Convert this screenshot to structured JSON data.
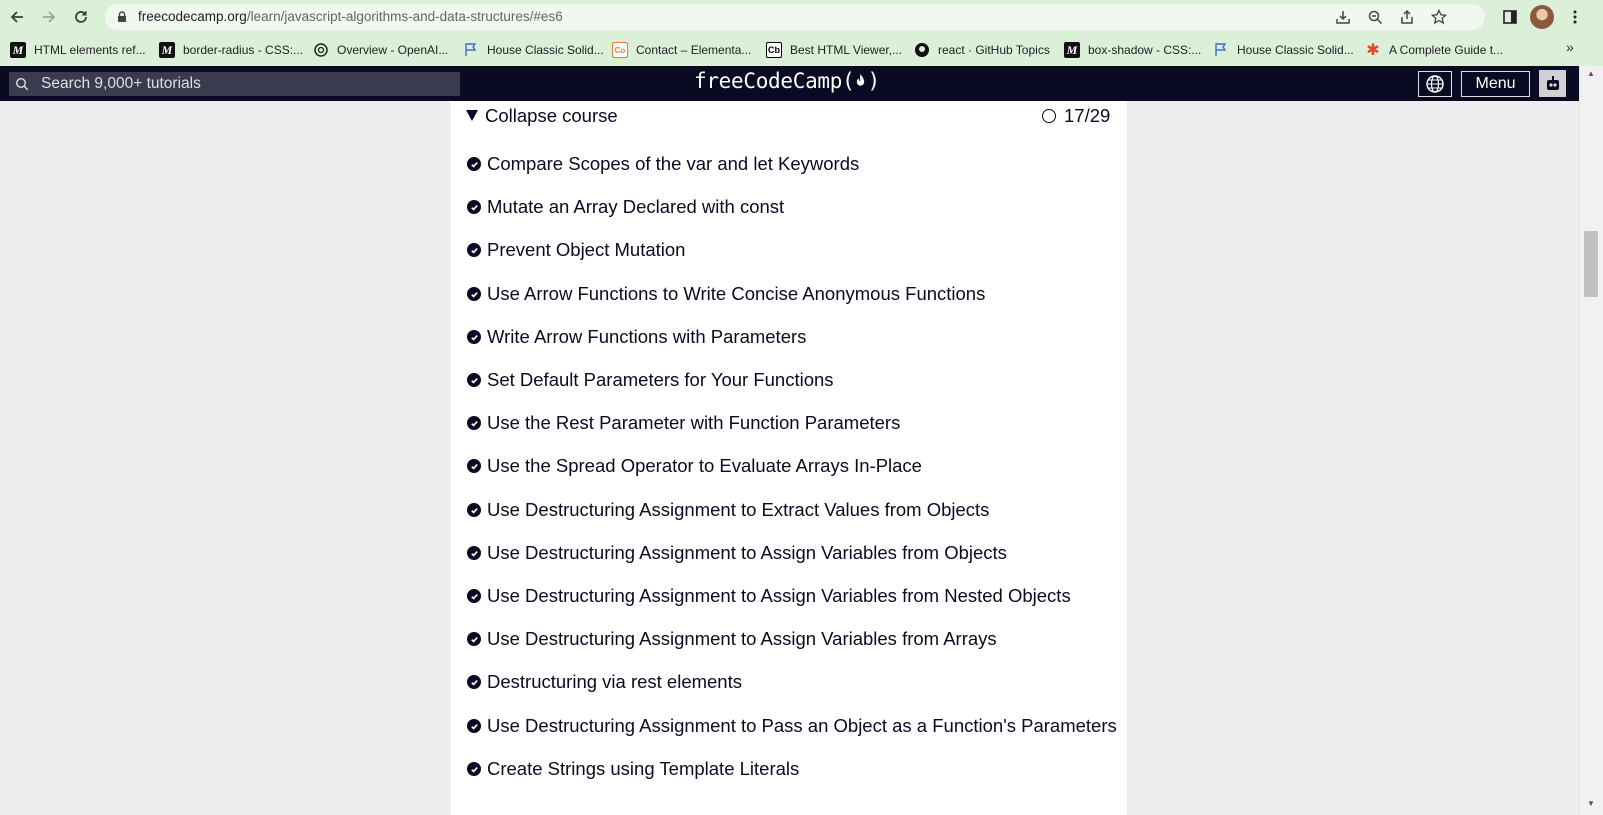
{
  "browser": {
    "url_host": "freecodecamp.org",
    "url_path": "/learn/javascript-algorithms-and-data-structures/#es6",
    "bookmarks": [
      {
        "label": "HTML elements ref...",
        "icon": "mdn-icon"
      },
      {
        "label": "border-radius - CSS:...",
        "icon": "mdn-icon"
      },
      {
        "label": "Overview - OpenAI...",
        "icon": "openai-icon"
      },
      {
        "label": "House Classic Solid...",
        "icon": "flag-icon"
      },
      {
        "label": "Contact – Elementa...",
        "icon": "codeorg-icon"
      },
      {
        "label": "Best HTML Viewer,...",
        "icon": "cb-icon"
      },
      {
        "label": "react · GitHub Topics",
        "icon": "github-icon"
      },
      {
        "label": "box-shadow - CSS:...",
        "icon": "mdn-icon"
      },
      {
        "label": "House Classic Solid...",
        "icon": "flag-icon"
      },
      {
        "label": "A Complete Guide t...",
        "icon": "asterisk-icon"
      }
    ],
    "more_bookmarks": "»"
  },
  "fcc": {
    "search_placeholder": "Search 9,000+ tutorials",
    "logo": "freeCodeCamp(🔥)",
    "logo_text": "freeCodeCamp(",
    "logo_end": ")",
    "menu_label": "Menu"
  },
  "course": {
    "collapse_label": "Collapse course",
    "progress": "17/29",
    "progress_completed": 17,
    "progress_total": 29,
    "lessons": [
      "Compare Scopes of the var and let Keywords",
      "Mutate an Array Declared with const",
      "Prevent Object Mutation",
      "Use Arrow Functions to Write Concise Anonymous Functions",
      "Write Arrow Functions with Parameters",
      "Set Default Parameters for Your Functions",
      "Use the Rest Parameter with Function Parameters",
      "Use the Spread Operator to Evaluate Arrays In-Place",
      "Use Destructuring Assignment to Extract Values from Objects",
      "Use Destructuring Assignment to Assign Variables from Objects",
      "Use Destructuring Assignment to Assign Variables from Nested Objects",
      "Use Destructuring Assignment to Assign Variables from Arrays",
      "Destructuring via rest elements",
      "Use Destructuring Assignment to Pass an Object as a Function's Parameters",
      "Create Strings using Template Literals"
    ]
  },
  "colors": {
    "chrome_bg": "#dbefd9",
    "fcc_nav_bg": "#0a0a23",
    "panel_bg": "#ffffff",
    "page_bg": "#eeeef0"
  }
}
